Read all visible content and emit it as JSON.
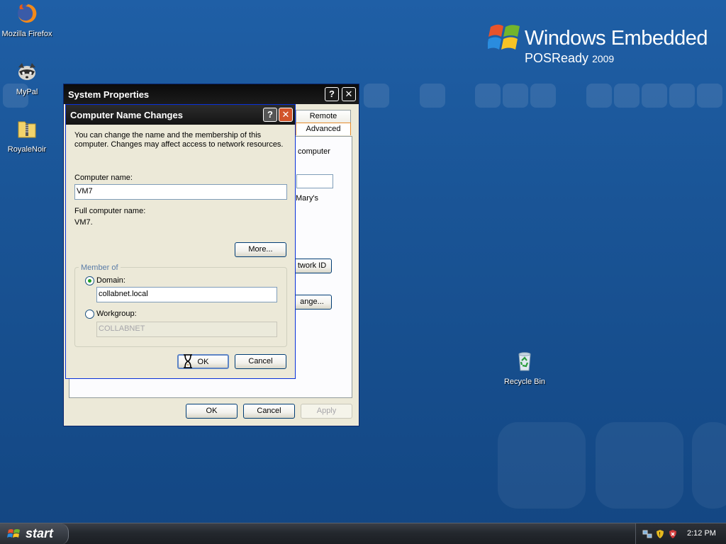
{
  "desktop": {
    "brand": {
      "name": "Windows Embedded",
      "edition": "POSReady",
      "year": "2009"
    },
    "icons": [
      {
        "label": "Mozilla Firefox"
      },
      {
        "label": "MyPal"
      },
      {
        "label": "RoyaleNoir"
      },
      {
        "label": "Recycle Bin"
      }
    ]
  },
  "system_properties": {
    "title": "System Properties",
    "tabs": [
      "Remote",
      "Advanced"
    ],
    "partial_texts": {
      "computer": "computer",
      "marys": "Mary's"
    },
    "network_id_button": "twork ID",
    "change_button": "ange...",
    "ok_label": "OK",
    "cancel_label": "Cancel",
    "apply_label": "Apply"
  },
  "computer_name_changes": {
    "title": "Computer Name Changes",
    "description": "You can change the name and the membership of this computer. Changes may affect access to network resources.",
    "computer_name_label": "Computer name:",
    "computer_name_value": "VM7",
    "full_name_label": "Full computer name:",
    "full_name_value": "VM7.",
    "more_button": "More...",
    "member_of_label": "Member of",
    "domain_label": "Domain:",
    "domain_value": "collabnet.local",
    "domain_selected": true,
    "workgroup_label": "Workgroup:",
    "workgroup_value": "COLLABNET",
    "ok_label": "OK",
    "cancel_label": "Cancel"
  },
  "taskbar": {
    "start_label": "start",
    "clock": "2:12 PM"
  },
  "colors": {
    "titlebar": "#0a246a",
    "desktop": "#1a5597",
    "close_button": "#d2542b"
  }
}
